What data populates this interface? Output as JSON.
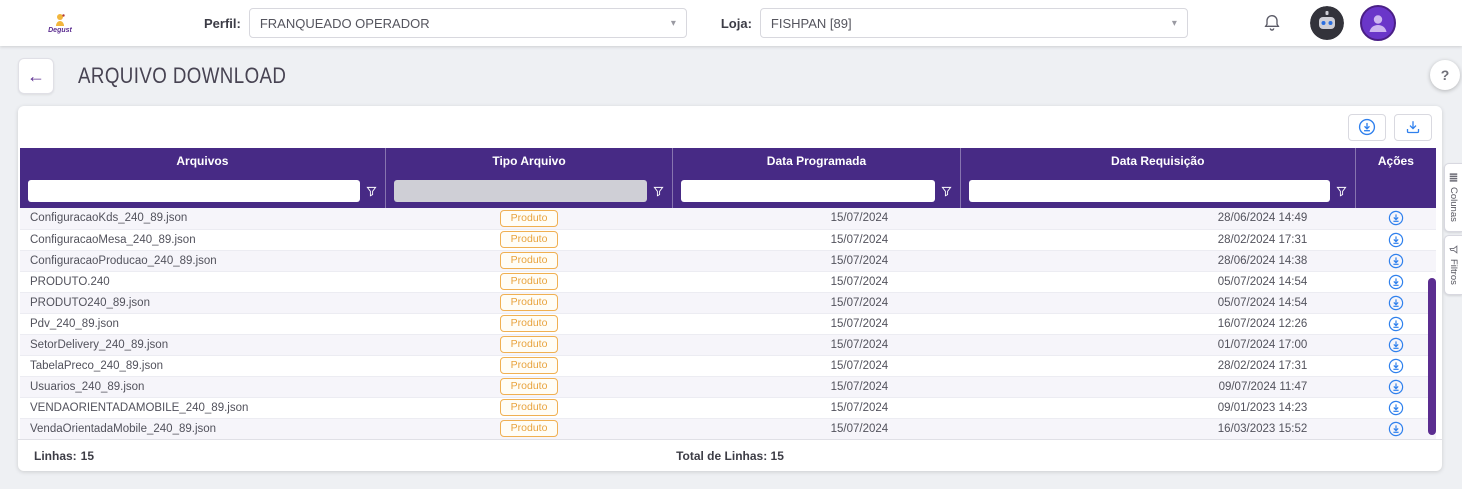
{
  "topbar": {
    "logo": "Degust",
    "perfil": {
      "label": "Perfil:",
      "value": "FRANQUEADO OPERADOR"
    },
    "loja": {
      "label": "Loja:",
      "value": "FISHPAN [89]"
    }
  },
  "icons": {
    "dropdown_caret": "▾",
    "back_arrow": "←",
    "help": "?"
  },
  "page": {
    "title": "ARQUIVO DOWNLOAD"
  },
  "side_tabs": {
    "colunas": "Colunas",
    "filtros": "Filtros"
  },
  "table": {
    "columns": [
      "Arquivos",
      "Tipo Arquivo",
      "Data Programada",
      "Data Requisição",
      "Ações"
    ],
    "rows": [
      {
        "arquivo": "ConfiguracaoKds_240_89.json",
        "tipo": "Produto",
        "programada": "15/07/2024",
        "requisicao": "28/06/2024 14:49"
      },
      {
        "arquivo": "ConfiguracaoMesa_240_89.json",
        "tipo": "Produto",
        "programada": "15/07/2024",
        "requisicao": "28/02/2024 17:31"
      },
      {
        "arquivo": "ConfiguracaoProducao_240_89.json",
        "tipo": "Produto",
        "programada": "15/07/2024",
        "requisicao": "28/06/2024 14:38"
      },
      {
        "arquivo": "PRODUTO.240",
        "tipo": "Produto",
        "programada": "15/07/2024",
        "requisicao": "05/07/2024 14:54"
      },
      {
        "arquivo": "PRODUTO240_89.json",
        "tipo": "Produto",
        "programada": "15/07/2024",
        "requisicao": "05/07/2024 14:54"
      },
      {
        "arquivo": "Pdv_240_89.json",
        "tipo": "Produto",
        "programada": "15/07/2024",
        "requisicao": "16/07/2024 12:26"
      },
      {
        "arquivo": "SetorDelivery_240_89.json",
        "tipo": "Produto",
        "programada": "15/07/2024",
        "requisicao": "01/07/2024 17:00"
      },
      {
        "arquivo": "TabelaPreco_240_89.json",
        "tipo": "Produto",
        "programada": "15/07/2024",
        "requisicao": "28/02/2024 17:31"
      },
      {
        "arquivo": "Usuarios_240_89.json",
        "tipo": "Produto",
        "programada": "15/07/2024",
        "requisicao": "09/07/2024 11:47"
      },
      {
        "arquivo": "VENDAORIENTADAMOBILE_240_89.json",
        "tipo": "Produto",
        "programada": "15/07/2024",
        "requisicao": "09/01/2023 14:23"
      },
      {
        "arquivo": "VendaOrientadaMobile_240_89.json",
        "tipo": "Produto",
        "programada": "15/07/2024",
        "requisicao": "16/03/2023 15:52"
      }
    ],
    "footer": {
      "linhas_label": "Linhas:",
      "linhas_value": "15",
      "total_label": "Total de Linhas:",
      "total_value": "15"
    },
    "colors": {
      "header": "#472a85",
      "badge": "#e8a33d",
      "action": "#2f80ed",
      "scrollbar": "#5b2d90"
    }
  }
}
